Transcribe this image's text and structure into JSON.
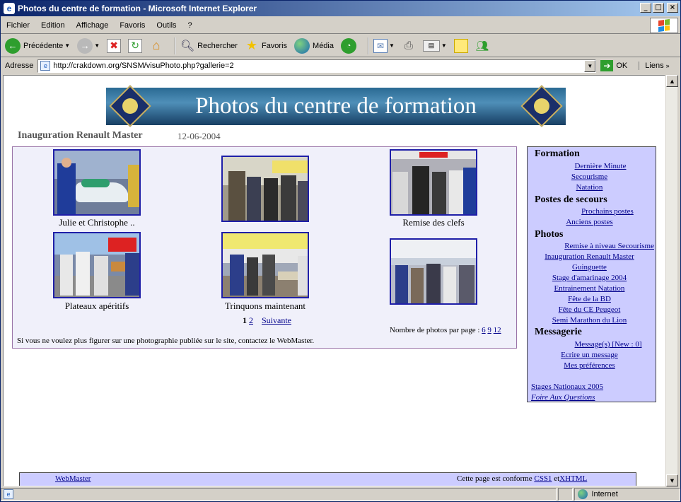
{
  "window": {
    "title": "Photos du centre de formation - Microsoft Internet Explorer",
    "controls": [
      "_",
      "□",
      "×"
    ]
  },
  "menubar": {
    "items": [
      "Fichier",
      "Edition",
      "Affichage",
      "Favoris",
      "Outils",
      "?"
    ]
  },
  "toolbar": {
    "back_label": "Précédente",
    "search_label": "Rechercher",
    "favorites_label": "Favoris",
    "media_label": "Média"
  },
  "address": {
    "label": "Adresse",
    "url": "http://crakdown.org/SNSM/visuPhoto.php?gallerie=2",
    "go_label": "OK",
    "links_label": "Liens"
  },
  "page": {
    "banner_title": "Photos du centre de formation",
    "gallery_title": "Inauguration Renault Master",
    "gallery_date": "12-06-2004",
    "photos": [
      {
        "caption": "Julie et Christophe .."
      },
      {
        "caption": ""
      },
      {
        "caption": "Remise des clefs"
      },
      {
        "caption": "Plateaux apéritifs"
      },
      {
        "caption": "Trinquons maintenant"
      },
      {
        "caption": ""
      }
    ],
    "pager": {
      "current": "1",
      "page2": "2",
      "next": "Suivante"
    },
    "per_page": {
      "label": "Nombre de photos par page :",
      "options": [
        "6",
        "9",
        "12"
      ]
    },
    "notice": "Si vous ne voulez plus figurer sur une photographie publiée sur le site, contactez le WebMaster."
  },
  "menu": {
    "sections": [
      {
        "title": "Formation",
        "links": [
          "Dernière Minute",
          "Secourisme",
          "Natation"
        ]
      },
      {
        "title": "Postes de secours",
        "links": [
          "Prochains postes",
          "Anciens postes"
        ]
      },
      {
        "title": "Photos",
        "links": [
          "Remise à niveau Secourisme",
          "Inauguration Renault Master",
          "Guinguette",
          "Stage d'amarinage 2004",
          "Entrainement Natation",
          "Fête de la BD",
          "Fête du CE Peugeot",
          "Semi Marathon du Lion"
        ]
      },
      {
        "title": "Messagerie",
        "links": [
          "Message(s) [New : 0]",
          "Ecrire un message",
          "Mes préférences"
        ]
      }
    ],
    "extra_links": [
      "Stages Nationaux 2005",
      "Foire Aux Questions"
    ]
  },
  "footer": {
    "webmaster": "WebMaster",
    "conform_text": "Cette page est conforme",
    "css": "CSS1",
    "and": "et",
    "xhtml": "XHTML"
  },
  "statusbar": {
    "zone": "Internet"
  }
}
